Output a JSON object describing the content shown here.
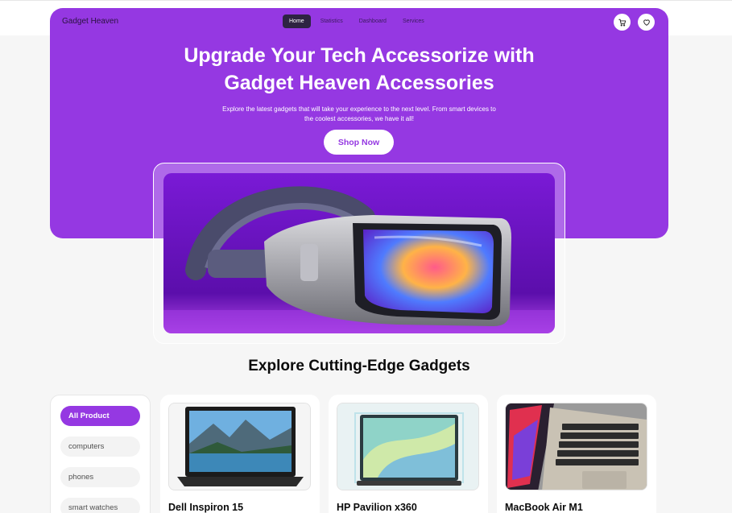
{
  "nav": {
    "brand": "Gadget Heaven",
    "links": [
      "Home",
      "Statistics",
      "Dashboard",
      "Services"
    ],
    "active": "Home",
    "icons": [
      "cart-icon",
      "heart-icon"
    ]
  },
  "hero": {
    "title_line1": "Upgrade Your Tech Accessorize with",
    "title_line2": "Gadget Heaven Accessories",
    "subtitle_line1": "Explore the latest gadgets that will take your experience to the next level. From smart devices to",
    "subtitle_line2": "the coolest accessories, we have it all!",
    "cta": "Shop Now",
    "banner_image": "vr-headset"
  },
  "section": {
    "title": "Explore Cutting-Edge Gadgets"
  },
  "categories": [
    "All Product",
    "computers",
    "phones",
    "smart watches"
  ],
  "active_category": "All Product",
  "products": [
    {
      "name": "Dell Inspiron 15",
      "image": "laptop-lake-wallpaper"
    },
    {
      "name": "HP Pavilion x360",
      "image": "convertible-laptop"
    },
    {
      "name": "MacBook Air M1",
      "image": "macbook-keyboard"
    }
  ],
  "colors": {
    "brand": "#9538e2",
    "dark": "#2e2342",
    "bg": "#f6f6f6"
  }
}
